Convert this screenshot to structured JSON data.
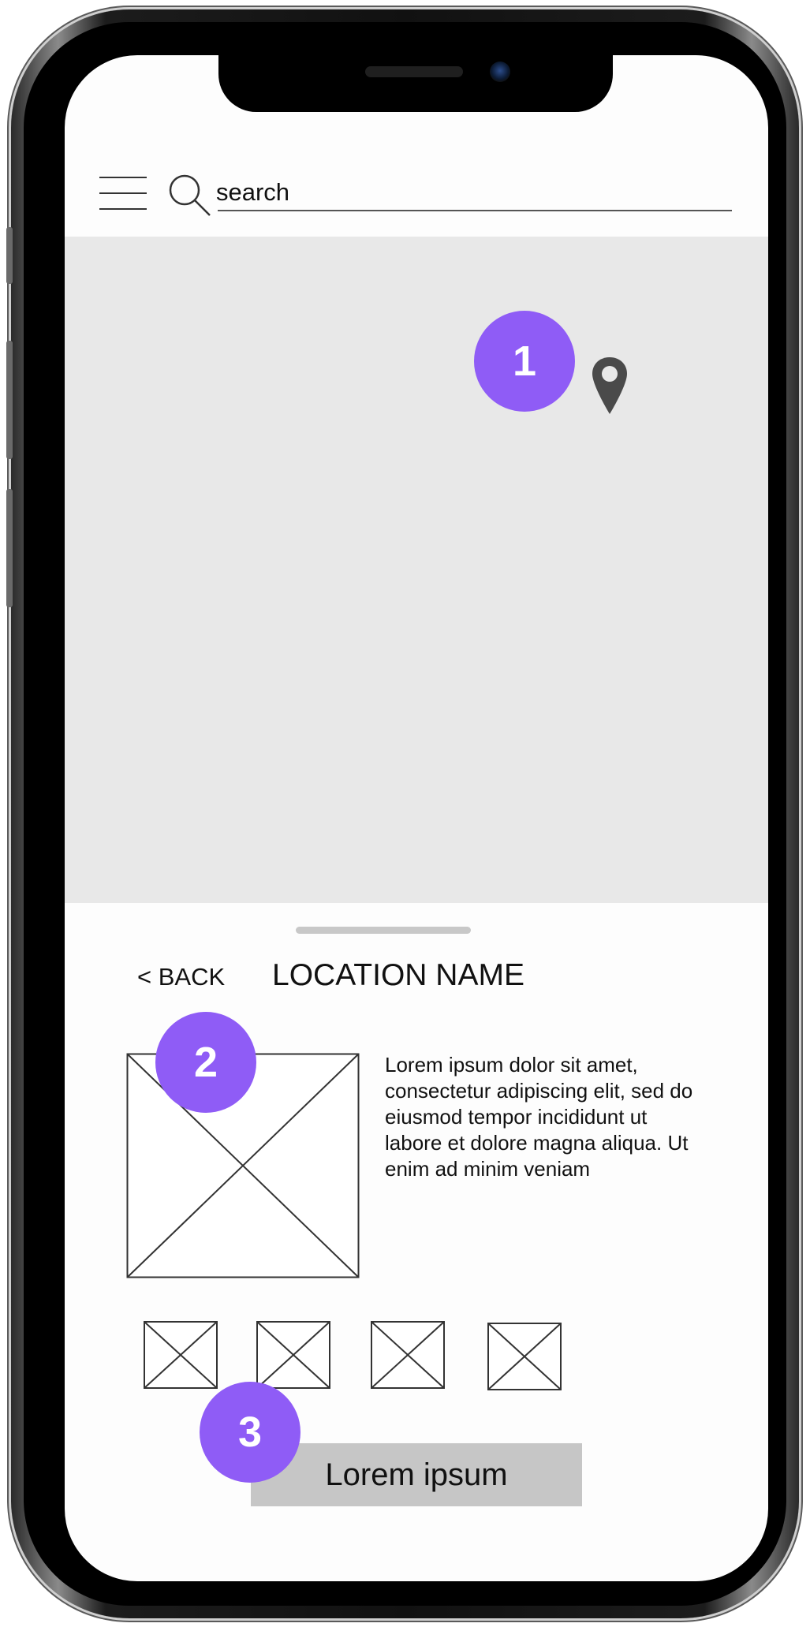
{
  "search": {
    "placeholder": "search"
  },
  "map": {
    "pin_icon": "location-pin-icon"
  },
  "markers": [
    "1",
    "2",
    "3"
  ],
  "sheet": {
    "back_label": "< BACK",
    "title": "LOCATION NAME",
    "description": "Lorem ipsum dolor sit amet, consectetur adipiscing elit, sed do eiusmod tempor incididunt ut labore et dolore magna aliqua. Ut enim ad minim veniam",
    "button_label": "Lorem ipsum"
  },
  "colors": {
    "marker": "#8f5cf6",
    "map_background": "#e8e8e8",
    "button_background": "#c6c6c6"
  }
}
